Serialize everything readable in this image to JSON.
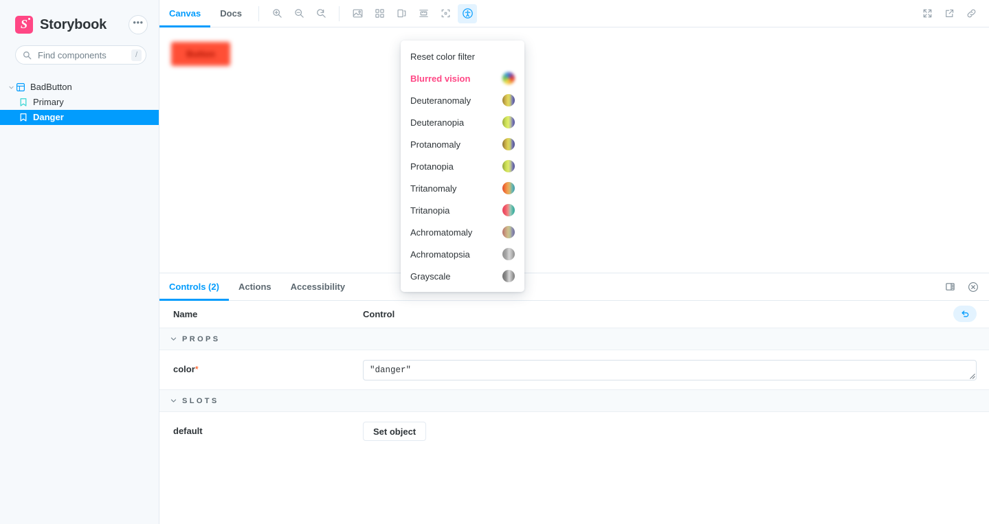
{
  "sidebar": {
    "brand": {
      "title": "Storybook",
      "logo_letter": "S",
      "menu_label": "•••"
    },
    "search": {
      "placeholder": "Find components",
      "value": "",
      "shortcut": "/"
    },
    "tree": [
      {
        "label": "BadButton",
        "type": "component",
        "icon": "component-icon",
        "expanded": true,
        "selected": false
      },
      {
        "label": "Primary",
        "type": "story",
        "icon": "story-bookmark-icon",
        "selected": false
      },
      {
        "label": "Danger",
        "type": "story",
        "icon": "story-bookmark-icon",
        "selected": true
      }
    ]
  },
  "preview_toolbar": {
    "tabs": [
      {
        "label": "Canvas",
        "active": true
      },
      {
        "label": "Docs",
        "active": false
      }
    ],
    "tools": [
      {
        "name": "zoom-in-icon",
        "active": false
      },
      {
        "name": "zoom-out-icon",
        "active": false
      },
      {
        "name": "zoom-reset-icon",
        "active": false
      },
      {
        "name": "backgrounds-icon",
        "active": false
      },
      {
        "name": "grid-icon",
        "active": false
      },
      {
        "name": "viewport-icon",
        "active": false
      },
      {
        "name": "measure-icon",
        "active": false
      },
      {
        "name": "outline-icon",
        "active": false
      },
      {
        "name": "accessibility-icon",
        "active": true
      }
    ],
    "right_tools": [
      {
        "name": "fullscreen-icon"
      },
      {
        "name": "open-in-new-tab-icon"
      },
      {
        "name": "copy-link-icon"
      }
    ]
  },
  "canvas": {
    "story_button_label": "Button"
  },
  "color_filter_menu": {
    "items": [
      {
        "label": "Reset color filter",
        "highlight": false,
        "swatch": null
      },
      {
        "label": "Blurred vision",
        "highlight": true,
        "swatch": "blurred"
      },
      {
        "label": "Deuteranomaly",
        "highlight": false,
        "swatch": "deuteranomaly"
      },
      {
        "label": "Deuteranopia",
        "highlight": false,
        "swatch": "deuteranopia"
      },
      {
        "label": "Protanomaly",
        "highlight": false,
        "swatch": "protanomaly"
      },
      {
        "label": "Protanopia",
        "highlight": false,
        "swatch": "protanopia"
      },
      {
        "label": "Tritanomaly",
        "highlight": false,
        "swatch": "tritanomaly"
      },
      {
        "label": "Tritanopia",
        "highlight": false,
        "swatch": "tritanopia"
      },
      {
        "label": "Achromatomaly",
        "highlight": false,
        "swatch": "achromatomaly"
      },
      {
        "label": "Achromatopsia",
        "highlight": false,
        "swatch": "achromatopsia"
      },
      {
        "label": "Grayscale",
        "highlight": false,
        "swatch": "grayscale"
      }
    ]
  },
  "addon_panel": {
    "tabs": [
      {
        "label": "Controls (2)",
        "active": true
      },
      {
        "label": "Actions",
        "active": false
      },
      {
        "label": "Accessibility",
        "active": false
      }
    ],
    "right_icons": [
      {
        "name": "panel-position-icon"
      },
      {
        "name": "close-panel-icon"
      }
    ],
    "table": {
      "headers": {
        "name": "Name",
        "control": "Control"
      },
      "reset_icon": "reset-controls-icon",
      "groups": [
        {
          "title": "PROPS",
          "rows": [
            {
              "name": "color",
              "required": true,
              "required_marker": "*",
              "control_type": "textarea",
              "value": "\"danger\""
            }
          ]
        },
        {
          "title": "SLOTS",
          "rows": [
            {
              "name": "default",
              "required": false,
              "required_marker": "",
              "control_type": "button",
              "value": "Set object"
            }
          ]
        }
      ]
    }
  },
  "colors": {
    "accent_blue": "#029cfd",
    "brand_pink": "#ff4785",
    "selected_row": "#029cfd",
    "story_button": "#ff4f36",
    "required_marker": "#ff4400",
    "sidebar_bg": "#f6f9fc",
    "border": "#e3eaf1"
  }
}
